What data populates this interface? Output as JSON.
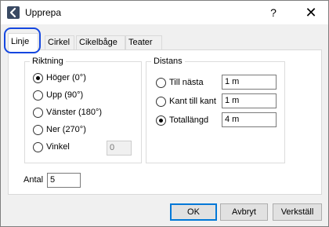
{
  "window": {
    "title": "Upprepa",
    "help": "?",
    "close": "✕"
  },
  "tabs": [
    {
      "label": "Linje",
      "active": true
    },
    {
      "label": "Cirkel"
    },
    {
      "label": "Cikelbåge"
    },
    {
      "label": "Teater"
    }
  ],
  "direction": {
    "legend": "Riktning",
    "options": [
      {
        "label": "Höger (0°)",
        "checked": true
      },
      {
        "label": "Upp (90°)"
      },
      {
        "label": "Vänster (180°)"
      },
      {
        "label": "Ner (270°)"
      },
      {
        "label": "Vinkel"
      }
    ],
    "angle_value": "0"
  },
  "distance": {
    "legend": "Distans",
    "options": [
      {
        "label": "Till nästa",
        "value": "1 m"
      },
      {
        "label": "Kant till kant",
        "value": "1 m"
      },
      {
        "label": "Totallängd",
        "value": "4 m",
        "checked": true
      }
    ]
  },
  "count": {
    "label": "Antal",
    "value": "5"
  },
  "buttons": {
    "ok": "OK",
    "cancel": "Avbryt",
    "apply": "Verkställ"
  },
  "colors": {
    "highlight": "#1547e0",
    "default_button_border": "#0078d7"
  }
}
